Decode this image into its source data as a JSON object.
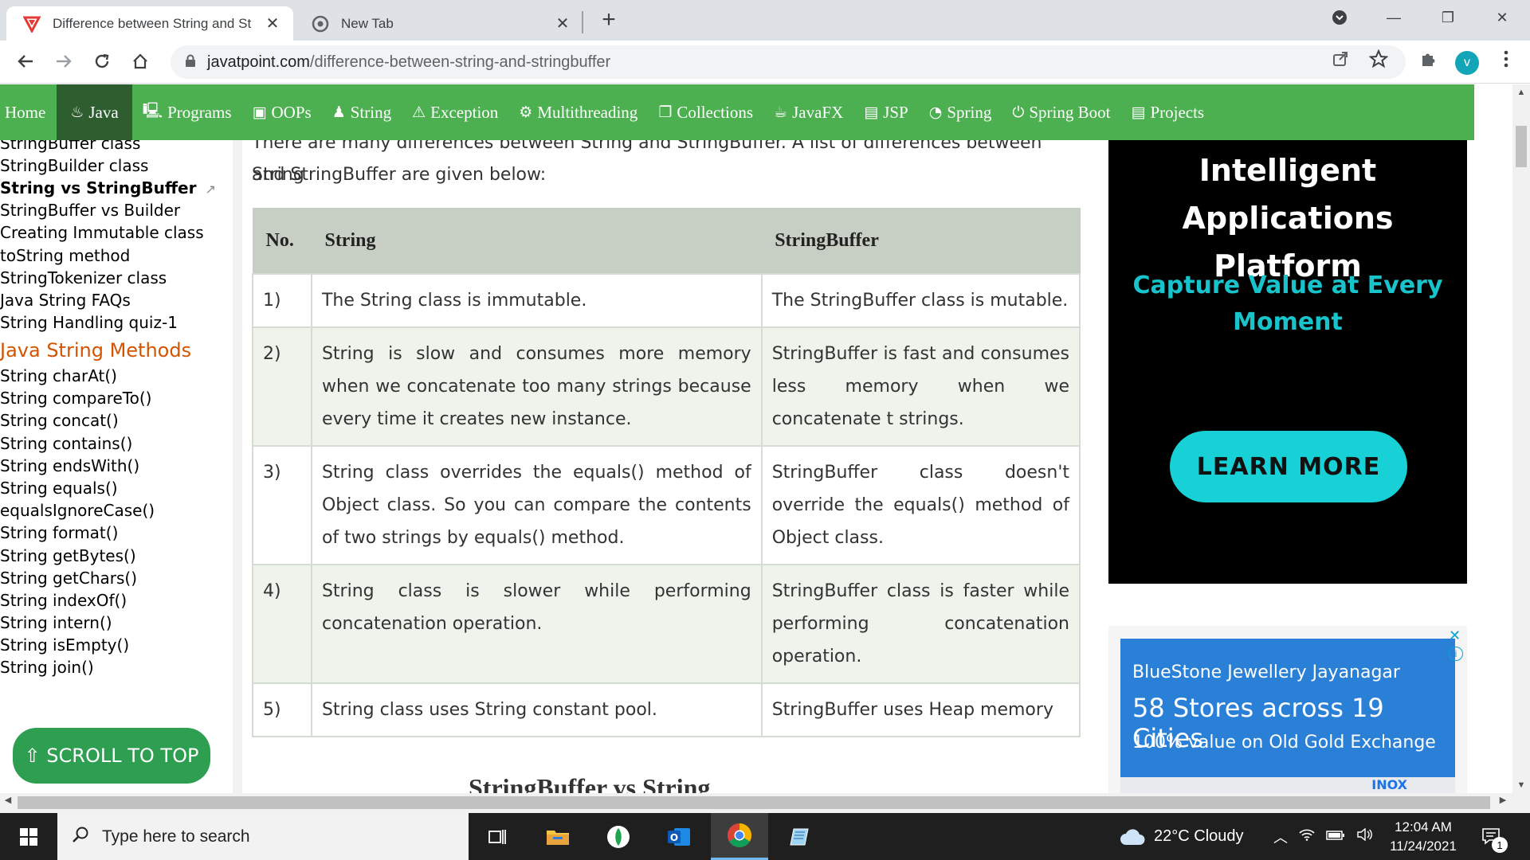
{
  "browser": {
    "tabs": [
      {
        "title": "Difference between String and St",
        "close": "✕"
      },
      {
        "title": "New Tab",
        "close": "✕"
      }
    ],
    "new_tab": "+",
    "url_domain": "javatpoint.com",
    "url_path": "/difference-between-string-and-stringbuffer",
    "profile_initial": "v",
    "window": {
      "minimize": "—",
      "restore": "❐",
      "close": "✕"
    }
  },
  "nav": {
    "items": [
      {
        "label": "Home",
        "icon": ""
      },
      {
        "label": "Java",
        "icon": "♨"
      },
      {
        "label": "Programs",
        "icon": "🖳"
      },
      {
        "label": "OOPs",
        "icon": "▣"
      },
      {
        "label": "String",
        "icon": "♟"
      },
      {
        "label": "Exception",
        "icon": "⚠"
      },
      {
        "label": "Multithreading",
        "icon": "⚙"
      },
      {
        "label": "Collections",
        "icon": "❐"
      },
      {
        "label": "JavaFX",
        "icon": "☕"
      },
      {
        "label": "JSP",
        "icon": "▤"
      },
      {
        "label": "Spring",
        "icon": "◔"
      },
      {
        "label": "Spring Boot",
        "icon": "⏻"
      },
      {
        "label": "Projects",
        "icon": "▤"
      }
    ]
  },
  "sidebar": {
    "links_top": [
      "StringBuffer class",
      "StringBuilder class",
      "String vs StringBuffer",
      "StringBuffer vs Builder",
      "Creating Immutable class",
      "toString method",
      "StringTokenizer class",
      "Java String FAQs",
      "String Handling quiz-1"
    ],
    "heading": "Java String Methods",
    "links_methods": [
      "String charAt()",
      "String compareTo()",
      "String concat()",
      "String contains()",
      "String endsWith()",
      "String equals()",
      "equalsIgnoreCase()",
      "String format()",
      "String getBytes()",
      "String getChars()",
      "String indexOf()",
      "String intern()",
      "String isEmpty()",
      "String join()"
    ],
    "external_icon": "↗"
  },
  "content": {
    "intro_line1": "There are many differences between String and StringBuffer. A list of differences between String",
    "intro_line2": "and StringBuffer are given below:",
    "table": {
      "headers": [
        "No.",
        "String",
        "StringBuffer"
      ],
      "rows": [
        {
          "no": "1)",
          "string": "The String class is immutable.",
          "buffer": "The StringBuffer class is mutable."
        },
        {
          "no": "2)",
          "string": "String is slow and consumes more memory when we concatenate too many strings because every time it creates new instance.",
          "buffer": "StringBuffer is fast and consumes less memory when we concatenate t strings."
        },
        {
          "no": "3)",
          "string": "String class overrides the equals() method of Object class. So you can compare the contents of two strings by equals() method.",
          "buffer": "StringBuffer class doesn't override the equals() method of Object class."
        },
        {
          "no": "4)",
          "string": "String class is slower while performing concatenation operation.",
          "buffer": "StringBuffer class is faster while performing concatenation operation."
        },
        {
          "no": "5)",
          "string": "String class uses String constant pool.",
          "buffer": "StringBuffer uses Heap memory"
        }
      ]
    },
    "next_heading": "StringBuffer vs String"
  },
  "ads": {
    "ad1": {
      "title": "Intelligent Applications Platform",
      "subtitle": "Capture Value at Every Moment",
      "cta": "LEARN MORE"
    },
    "ad2": {
      "line1": "BlueStone Jewellery Jayanagar",
      "line2": "58 Stores across 19 Cities",
      "line3": "100% value on Old Gold Exchange",
      "map_label": "INOX"
    }
  },
  "scroll_to_top": "⇧ SCROLL TO TOP",
  "taskbar": {
    "search_placeholder": "Type here to search",
    "weather": "22°C  Cloudy",
    "time": "12:04 AM",
    "date": "11/24/2021",
    "notifications": "1"
  }
}
